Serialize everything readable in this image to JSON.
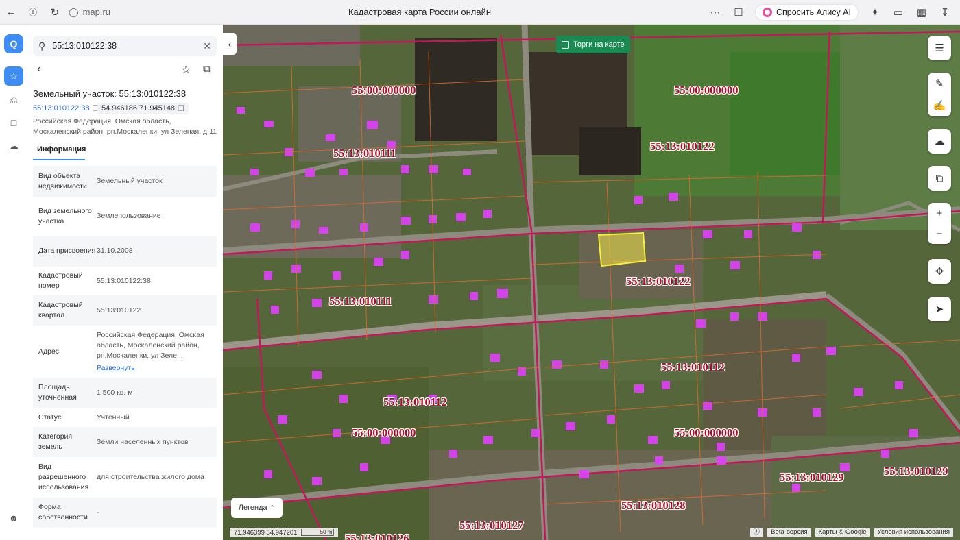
{
  "browser": {
    "url": "map.ru",
    "title": "Кадастровая карта России онлайн",
    "alice_button": "Спросить Алису AI"
  },
  "panel": {
    "search_value": "55:13:010122:38",
    "object_title": "Земельный участок: 55:13:010122:38",
    "cadastral_link": "55:13:010122:38",
    "coordinates": "54.946186 71.945148",
    "address_line": "Российская Федерация, Омская область, Москаленский район, рп.Москаленки, ул Зеленая, д 11",
    "tab_info": "Информация",
    "rows": [
      {
        "key": "Вид объекта недвижимости",
        "value": "Земельный участок"
      },
      {
        "key": "Вид земельного участка",
        "value": "Землепользование"
      },
      {
        "key": "Дата присвоения",
        "value": "31.10.2008"
      },
      {
        "key": "Кадастровый номер",
        "value": "55:13:010122:38"
      },
      {
        "key": "Кадастровый квартал",
        "value": "55:13:010122"
      },
      {
        "key": "Адрес",
        "value": "Российская Федерация, Омская область, Москаленский район, рп.Москаленки, ул Зеле...",
        "action": "Развернуть"
      },
      {
        "key": "Площадь уточненная",
        "value": "1 500 кв. м"
      },
      {
        "key": "Статус",
        "value": "Учтенный"
      },
      {
        "key": "Категория земель",
        "value": "Земли населенных пунктов"
      },
      {
        "key": "Вид разрешенного использования",
        "value": "для строительства жилого дома"
      },
      {
        "key": "Форма собственности",
        "value": "-"
      }
    ]
  },
  "map": {
    "torgi_label": "Торги на карте",
    "legend_label": "Легенда",
    "cursor_coords": "71.946399  54.947201",
    "scale_label": "50 m",
    "beta_label": "Beta-версия",
    "maps_credit": "Карты © Google",
    "terms_label": "Условия использования",
    "quarter_labels": [
      "55:00:000000",
      "55:00:000000",
      "55:13:010122",
      "55:13:010111",
      "55:13:010122",
      "55:13:010111",
      "55:13:010112",
      "55:13:010112",
      "55:00:000000",
      "55:00:000000",
      "55:13:010129",
      "55:13:010129",
      "55:13:010128",
      "55:13:010127",
      "55:13:010126"
    ]
  },
  "colors": {
    "accent": "#3d8df5",
    "quarter_border": "#c2185b",
    "parcel_border": "#e06a2a",
    "building": "#e040fb",
    "selected_parcel": "#f2e54a",
    "torgi_green": "#1a8a52"
  }
}
